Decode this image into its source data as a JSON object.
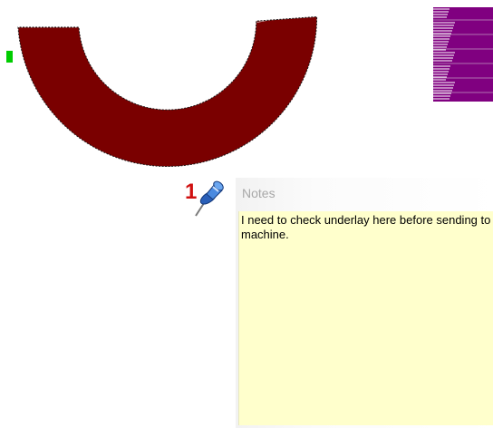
{
  "canvas": {
    "background_color": "#ffffff"
  },
  "design": {
    "arc_fill_color": "#7a0000",
    "arc_stitch_color": "#ffffff",
    "arc_outline_color": "#1a1a1a",
    "start_marker_color": "#00cc00",
    "purple_block_color": "#800080",
    "purple_stitch_color": "#ffffff"
  },
  "pin": {
    "number": "1",
    "icon": "pushpin-icon",
    "number_color": "#d01010",
    "pin_color": "#3a78d8"
  },
  "note": {
    "title": "Notes",
    "text": "I need to check underlay here before sending to machine.",
    "background_color": "#ffffcc"
  }
}
